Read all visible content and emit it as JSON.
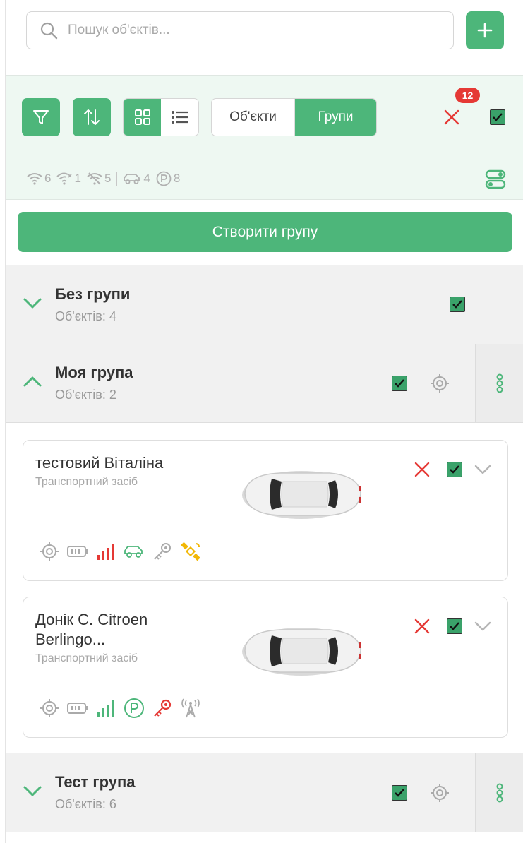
{
  "search": {
    "placeholder": "Пошук об'єктів..."
  },
  "toolbar": {
    "segment_objects": "Об'єкти",
    "segment_groups": "Групи",
    "badge_count": "12"
  },
  "stats": {
    "online": "6",
    "weak_signal": "1",
    "offline": "5",
    "moving": "4",
    "parked": "8"
  },
  "create_group_label": "Створити групу",
  "groups": [
    {
      "title": "Без групи",
      "subtitle": "Об'єктів: 4",
      "expanded": false
    },
    {
      "title": "Моя група",
      "subtitle": "Об'єктів: 2",
      "expanded": true
    },
    {
      "title": "Тест група",
      "subtitle": "Об'єктів: 6",
      "expanded": false
    }
  ],
  "objects": [
    {
      "title": "тестовий Віталіна",
      "subtitle": "Транспортний засіб",
      "status_icons": [
        "locate-icon",
        "battery-icon",
        "signal-bars-red-icon",
        "car-moving-icon",
        "key-icon",
        "satellite-yellow-icon"
      ]
    },
    {
      "title": "Донік С. Citroen Berlingo...",
      "subtitle": "Транспортний засіб",
      "status_icons": [
        "locate-icon",
        "battery-icon",
        "signal-bars-green-icon",
        "parking-icon",
        "key-red-icon",
        "antenna-icon"
      ]
    }
  ],
  "colors": {
    "accent": "#4db67a",
    "panel_bg": "#eef8f2",
    "danger": "#e53935",
    "muted": "#a8a8a8",
    "satellite": "#f2b705"
  }
}
